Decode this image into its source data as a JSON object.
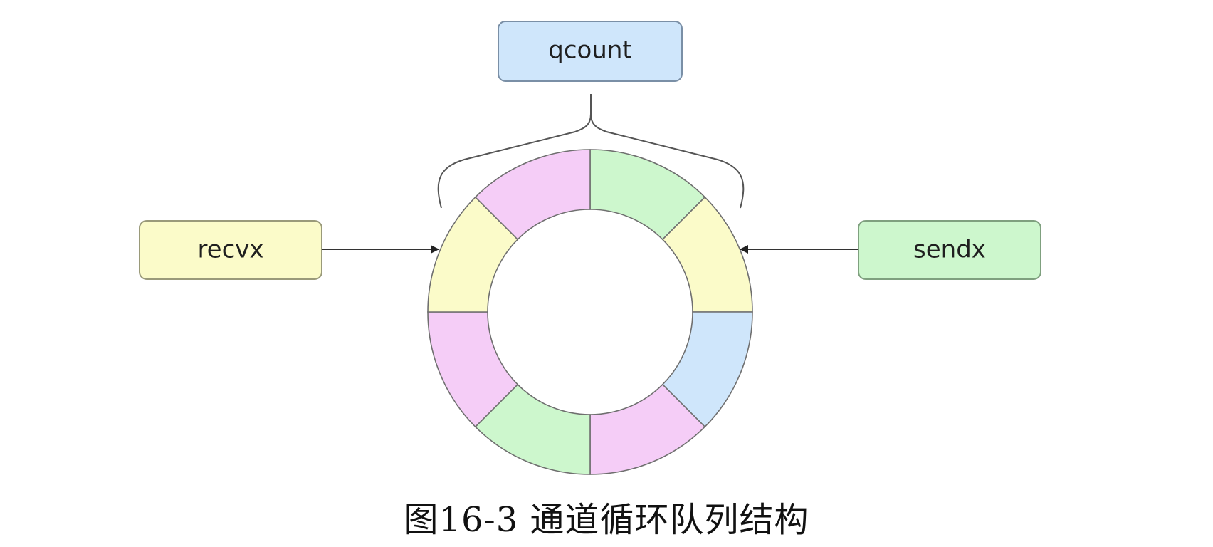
{
  "diagram": {
    "nodes": {
      "qcount": {
        "label": "qcount",
        "fill": "#cfe6fb",
        "stroke": "#7a8fa6"
      },
      "recvx": {
        "label": "recvx",
        "fill": "#fbfbc9",
        "stroke": "#9a9a7a"
      },
      "sendx": {
        "label": "sendx",
        "fill": "#cdf7cd",
        "stroke": "#7fa07f"
      }
    },
    "ring": {
      "segment_count": 8,
      "segments": [
        {
          "color": "#cdf7cd"
        },
        {
          "color": "#fbfbc9"
        },
        {
          "color": "#cfe6fb"
        },
        {
          "color": "#f5cdf7"
        },
        {
          "color": "#cdf7cd"
        },
        {
          "color": "#f5cdf7"
        },
        {
          "color": "#fbfbc9"
        },
        {
          "color": "#f5cdf7"
        }
      ]
    },
    "caption": "图16-3 通道循环队列结构"
  }
}
